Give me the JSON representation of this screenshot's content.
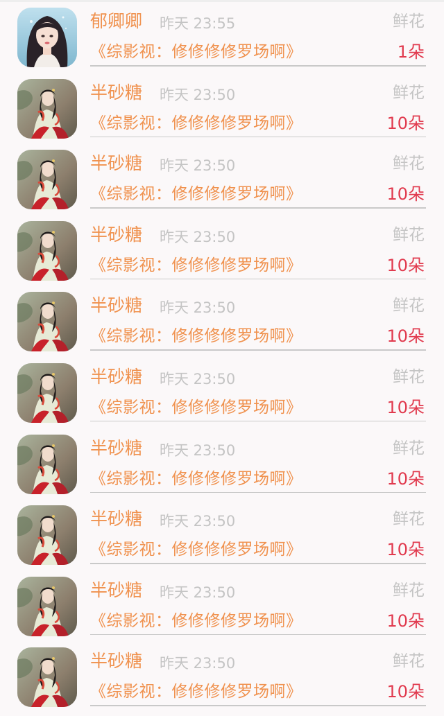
{
  "rows": [
    {
      "user": "郁卿卿",
      "time": "昨天 23:55",
      "gift_label": "鲜花",
      "book_title": "《综影视：修修修修罗场啊》",
      "count": "1朵",
      "avatar": "avatar-girl"
    },
    {
      "user": "半砂糖",
      "time": "昨天 23:50",
      "gift_label": "鲜花",
      "book_title": "《综影视：修修修修罗场啊》",
      "count": "10朵",
      "avatar": "avatar-ancient"
    },
    {
      "user": "半砂糖",
      "time": "昨天 23:50",
      "gift_label": "鲜花",
      "book_title": "《综影视：修修修修罗场啊》",
      "count": "10朵",
      "avatar": "avatar-ancient"
    },
    {
      "user": "半砂糖",
      "time": "昨天 23:50",
      "gift_label": "鲜花",
      "book_title": "《综影视：修修修修罗场啊》",
      "count": "10朵",
      "avatar": "avatar-ancient"
    },
    {
      "user": "半砂糖",
      "time": "昨天 23:50",
      "gift_label": "鲜花",
      "book_title": "《综影视：修修修修罗场啊》",
      "count": "10朵",
      "avatar": "avatar-ancient"
    },
    {
      "user": "半砂糖",
      "time": "昨天 23:50",
      "gift_label": "鲜花",
      "book_title": "《综影视：修修修修罗场啊》",
      "count": "10朵",
      "avatar": "avatar-ancient"
    },
    {
      "user": "半砂糖",
      "time": "昨天 23:50",
      "gift_label": "鲜花",
      "book_title": "《综影视：修修修修罗场啊》",
      "count": "10朵",
      "avatar": "avatar-ancient"
    },
    {
      "user": "半砂糖",
      "time": "昨天 23:50",
      "gift_label": "鲜花",
      "book_title": "《综影视：修修修修罗场啊》",
      "count": "10朵",
      "avatar": "avatar-ancient"
    },
    {
      "user": "半砂糖",
      "time": "昨天 23:50",
      "gift_label": "鲜花",
      "book_title": "《综影视：修修修修罗场啊》",
      "count": "10朵",
      "avatar": "avatar-ancient"
    },
    {
      "user": "半砂糖",
      "time": "昨天 23:50",
      "gift_label": "鲜花",
      "book_title": "《综影视：修修修修罗场啊》",
      "count": "10朵",
      "avatar": "avatar-ancient"
    }
  ],
  "colors": {
    "name": "#f0924f",
    "meta": "#c4c4c4",
    "count": "#e13a4e",
    "background": "#fbf8f9"
  }
}
